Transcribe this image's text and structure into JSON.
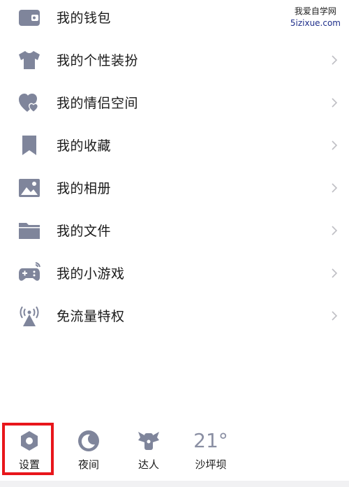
{
  "watermark": {
    "line1": "我爱自学网",
    "line2": "5izixue.com"
  },
  "menu": {
    "items": [
      {
        "label": "我的钱包",
        "icon": "wallet-icon",
        "has_arrow": false
      },
      {
        "label": "我的个性装扮",
        "icon": "tshirt-icon",
        "has_arrow": true
      },
      {
        "label": "我的情侣空间",
        "icon": "hearts-icon",
        "has_arrow": true
      },
      {
        "label": "我的收藏",
        "icon": "bookmark-icon",
        "has_arrow": true
      },
      {
        "label": "我的相册",
        "icon": "photo-icon",
        "has_arrow": true
      },
      {
        "label": "我的文件",
        "icon": "folder-icon",
        "has_arrow": true
      },
      {
        "label": "我的小游戏",
        "icon": "gamepad-icon",
        "has_arrow": true
      },
      {
        "label": "免流量特权",
        "icon": "signal-tower-icon",
        "has_arrow": true
      }
    ]
  },
  "bottom_bar": {
    "settings_label": "设置",
    "night_label": "夜间",
    "expert_label": "达人",
    "weather_temp": "21°",
    "weather_city": "沙坪坝"
  },
  "colors": {
    "icon": "#7f859b",
    "highlight": "#e8161b",
    "arrow": "#bfbfc4"
  }
}
